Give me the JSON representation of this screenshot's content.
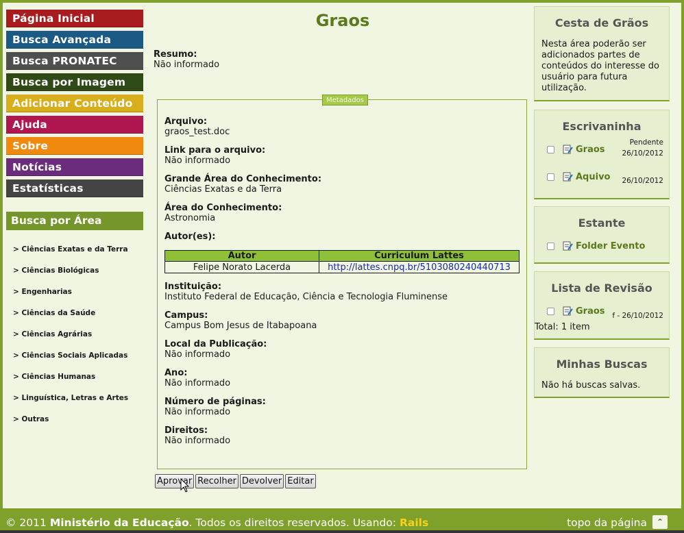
{
  "menu": {
    "items": [
      {
        "label": "Página Inicial",
        "color": "#a81c20"
      },
      {
        "label": "Busca Avançada",
        "color": "#1c5a86"
      },
      {
        "label": "Busca PRONATEC",
        "color": "#4f4f4f"
      },
      {
        "label": "Busca por Imagem",
        "color": "#2f4a16"
      },
      {
        "label": "Adicionar Conteúdo",
        "color": "#d9ae1c"
      },
      {
        "label": "Ajuda",
        "color": "#b0164f"
      },
      {
        "label": "Sobre",
        "color": "#ef8a0e"
      },
      {
        "label": "Notícias",
        "color": "#6b2c7e"
      },
      {
        "label": "Estatísticas",
        "color": "#444444"
      }
    ]
  },
  "area": {
    "header": "Busca por Área",
    "links": [
      "> Ciências Exatas e da Terra",
      "> Ciências Biológicas",
      "> Engenharias",
      "> Ciências da Saúde",
      "> Ciências Agrárias",
      "> Ciências Sociais Aplicadas",
      "> Ciências Humanas",
      "> Linguística, Letras e Artes",
      "> Outras"
    ]
  },
  "main": {
    "title": "Graos",
    "resumo_label": "Resumo:",
    "resumo_value": "Não informado",
    "legend": "Metadados",
    "fields": [
      {
        "label": "Arquivo:",
        "value": "graos_test.doc"
      },
      {
        "label": "Link para o arquivo:",
        "value": "Não informado"
      },
      {
        "label": "Grande Área do Conhecimento:",
        "value": "Ciências Exatas e da Terra"
      },
      {
        "label": "Área do Conhecimento:",
        "value": "Astronomia"
      }
    ],
    "autores_label": "Autor(es):",
    "table_headers": [
      "Autor",
      "Curriculum Lattes"
    ],
    "authors": [
      {
        "name": "Felipe Norato Lacerda",
        "lattes": "http://lattes.cnpq.br/5103080240440713"
      }
    ],
    "fields2": [
      {
        "label": "Instituição:",
        "value": "Instituto Federal de Educação, Ciência e Tecnologia Fluminense"
      },
      {
        "label": "Campus:",
        "value": "Campus Bom Jesus de Itabapoana"
      },
      {
        "label": "Local da Publicação:",
        "value": "Não informado"
      },
      {
        "label": "Ano:",
        "value": "Não informado"
      },
      {
        "label": "Número de páginas:",
        "value": "Não informado"
      },
      {
        "label": "Direitos:",
        "value": "Não informado"
      }
    ],
    "buttons": [
      "Aprovar",
      "Recolher",
      "Devolver",
      "Editar"
    ]
  },
  "sidebar": {
    "cesta": {
      "title": "Cesta de Grãos",
      "text": "Nesta área poderão ser adicionados partes de conteúdos do interesse do usuário para futura utilização."
    },
    "escrivaninha": {
      "title": "Escrivaninha",
      "items": [
        {
          "label": "Graos",
          "status": "Pendente",
          "date": "26/10/2012"
        },
        {
          "label": "Aquivo",
          "status": "",
          "date": "26/10/2012"
        }
      ]
    },
    "estante": {
      "title": "Estante",
      "items": [
        {
          "label": "Folder Evento"
        }
      ]
    },
    "revisao": {
      "title": "Lista de Revisão",
      "items": [
        {
          "label": "Graos",
          "meta": "f - 26/10/2012"
        }
      ],
      "total": "Total: 1 item"
    },
    "buscas": {
      "title": "Minhas Buscas",
      "text": "Não há buscas salvas."
    }
  },
  "footer": {
    "copy_prefix": "© 2011 ",
    "ministry": "Ministério da Educação",
    "copy_middle": ". Todos os direitos reservados. Usando: ",
    "rails": "Rails",
    "top_link": "topo da página",
    "top_btn_icon": "chevron-up-icon"
  }
}
